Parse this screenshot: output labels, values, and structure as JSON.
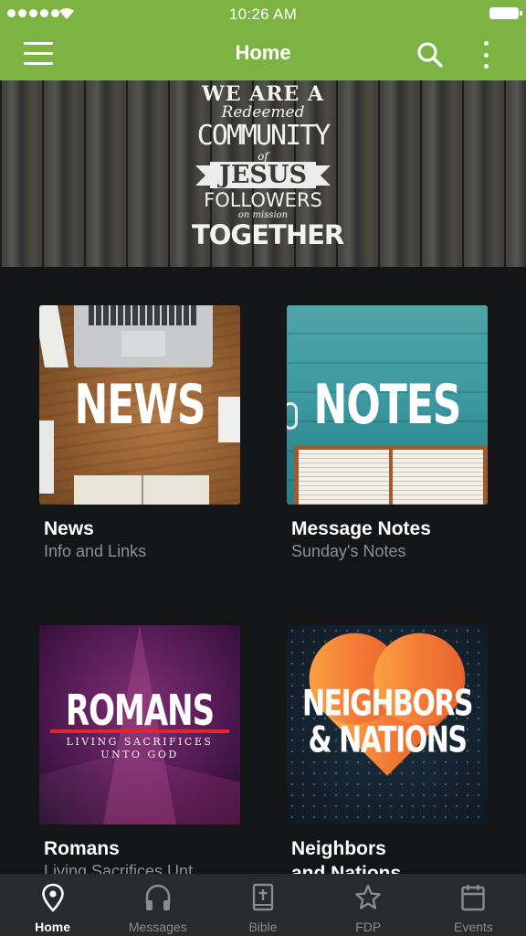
{
  "status_bar": {
    "time": "10:26 AM"
  },
  "app_bar": {
    "title": "Home"
  },
  "banner": {
    "lines": [
      "WE ARE A",
      "Redeemed",
      "COMMUNITY",
      "of",
      "JESUS",
      "FOLLOWERS",
      "on mission",
      "TOGETHER"
    ]
  },
  "cards": [
    {
      "image_text": "NEWS",
      "title": "News",
      "subtitle": "Info and Links"
    },
    {
      "image_text": "NOTES",
      "title": "Message Notes",
      "subtitle": "Sunday's Notes"
    },
    {
      "image_text": "ROMANS",
      "image_subtext": "LIVING SACRIFICES\nUNTO GOD",
      "title": "Romans",
      "subtitle": "Living Sacrifices Unt"
    },
    {
      "image_text_1": "NEIGHBORS",
      "image_text_2": "& NATIONS",
      "title": "Neighbors",
      "subtitle": "and Nations"
    }
  ],
  "tabs": [
    {
      "label": "Home",
      "icon": "map-pin-icon",
      "active": true
    },
    {
      "label": "Messages",
      "icon": "headphones-icon",
      "active": false
    },
    {
      "label": "Bible",
      "icon": "bible-icon",
      "active": false
    },
    {
      "label": "FDP",
      "icon": "star-icon",
      "active": false
    },
    {
      "label": "Events",
      "icon": "calendar-icon",
      "active": false
    }
  ],
  "colors": {
    "brand_green": "#7cb342",
    "background": "#141516",
    "tab_bar": "#292a2c",
    "accent_red": "#e0262d"
  }
}
